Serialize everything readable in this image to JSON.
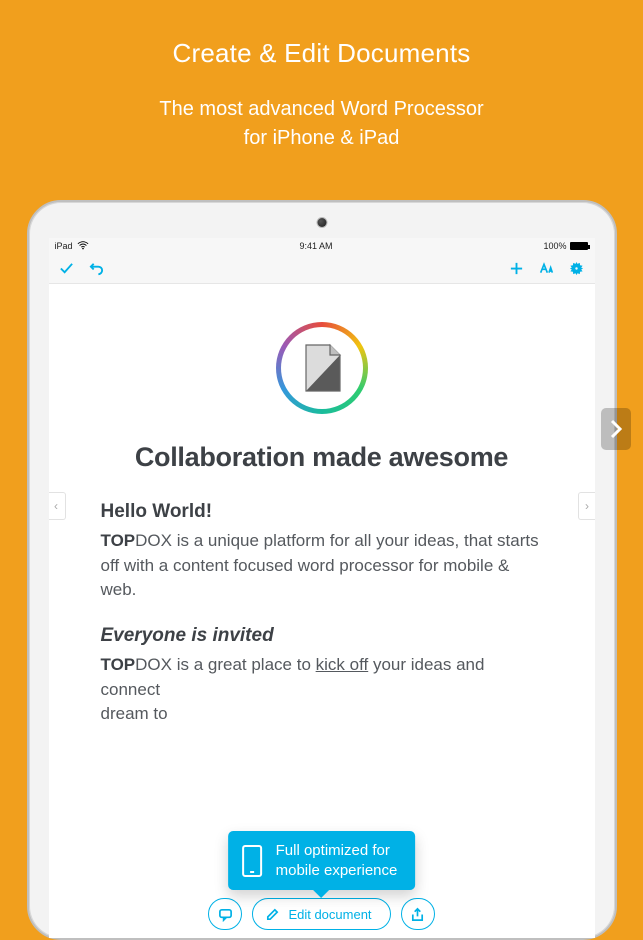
{
  "promo": {
    "title": "Create & Edit Documents",
    "subtitle_line1": "The most advanced Word Processor",
    "subtitle_line2": "for iPhone & iPad"
  },
  "statusbar": {
    "carrier": "iPad",
    "time": "9:41 AM",
    "battery_pct": "100%"
  },
  "toolbar": {
    "confirm_icon": "check-icon",
    "undo_icon": "undo-icon",
    "add_icon": "plus-icon",
    "font_icon": "font-style-icon",
    "settings_icon": "gear-icon"
  },
  "document": {
    "title": "Collaboration made awesome",
    "section1": {
      "heading": "Hello World!",
      "brand_bold": "TOP",
      "brand_rest": "DOX",
      "body_rest": " is a unique platform for all your ideas, that starts off with a content focused word processor for mobile & web."
    },
    "section2": {
      "heading": "Everyone is invited",
      "brand_bold": "TOP",
      "brand_rest": "DOX",
      "before_link": " is a great place to ",
      "link_text": "kick off",
      "after_link": " your ideas and",
      "line2": "connect",
      "line3": "dream to"
    }
  },
  "callout": {
    "line1": "Full optimized for",
    "line2": "mobile experience"
  },
  "actions": {
    "comment_icon": "comment-icon",
    "edit_label": "Edit document",
    "share_icon": "share-icon"
  },
  "colors": {
    "background": "#f19f1d",
    "accent": "#00b1e6"
  }
}
